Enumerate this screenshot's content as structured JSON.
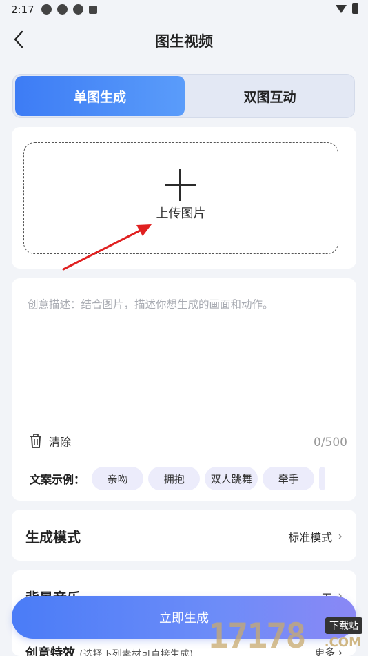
{
  "status_bar": {
    "time": "2:17"
  },
  "header": {
    "title": "图生视频"
  },
  "tabs": [
    {
      "label": "单图生成",
      "active": true
    },
    {
      "label": "双图互动",
      "active": false
    }
  ],
  "upload": {
    "label": "上传图片"
  },
  "description": {
    "placeholder": "创意描述：结合图片，描述你想生成的画面和动作。",
    "clear_label": "清除",
    "counter": "0/500"
  },
  "examples": {
    "label": "文案示例：",
    "chips": [
      "亲吻",
      "拥抱",
      "双人跳舞",
      "牵手"
    ]
  },
  "mode": {
    "title": "生成模式",
    "value": "标准模式"
  },
  "music": {
    "title": "背景音乐",
    "value": "无"
  },
  "effects": {
    "title": "创意特效",
    "hint": "(选择下列素材可直接生成)",
    "more": "更多"
  },
  "generate_button": {
    "label": "立即生成"
  },
  "watermark": {
    "number": "17178",
    "tag": "下载站",
    "com": ".COM"
  },
  "colors": {
    "accent": "#3d7cf5",
    "annotation_arrow": "#e02020"
  }
}
